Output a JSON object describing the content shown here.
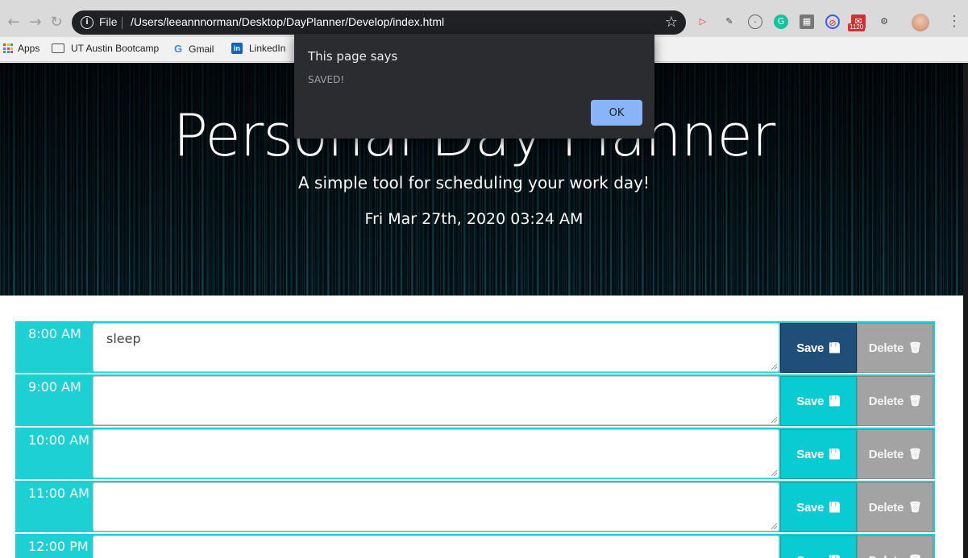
{
  "browser": {
    "scheme_label": "File",
    "url": "/Users/leeannnorman/Desktop/DayPlanner/Develop/index.html",
    "extension_badge": "1120",
    "bookmarks": [
      {
        "label": "Apps",
        "icon": "apps-grid-icon"
      },
      {
        "label": "UT Austin Bootcamp",
        "icon": "folder-icon"
      },
      {
        "label": "Gmail",
        "icon": "google-icon"
      },
      {
        "label": "LinkedIn",
        "icon": "linkedin-icon"
      }
    ]
  },
  "dialog": {
    "title": "This page says",
    "message": "SAVED!",
    "ok_label": "OK"
  },
  "header": {
    "title": "Personal Day Planner",
    "subtitle": "A simple tool for scheduling your work day!",
    "current_date": "Fri Mar 27th, 2020 03:24 AM"
  },
  "planner": {
    "save_label": "Save",
    "delete_label": "Delete",
    "rows": [
      {
        "hour": "8:00 AM",
        "text": "sleep",
        "active": true
      },
      {
        "hour": "9:00 AM",
        "text": "",
        "active": false
      },
      {
        "hour": "10:00 AM",
        "text": "",
        "active": false
      },
      {
        "hour": "11:00 AM",
        "text": "",
        "active": false
      },
      {
        "hour": "12:00 PM",
        "text": "",
        "active": false
      }
    ]
  },
  "colors": {
    "row_accent": "#1dd0d3",
    "save_button": "#08ccd1",
    "save_button_active": "#1f4e79",
    "delete_button": "#a3a3a3",
    "dialog_ok": "#8ab4f8"
  }
}
